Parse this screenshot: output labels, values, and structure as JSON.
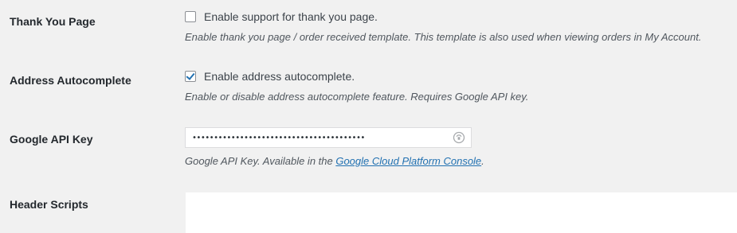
{
  "rows": [
    {
      "label": "Thank You Page",
      "checkbox_label": "Enable support for thank you page.",
      "checked": false,
      "description": "Enable thank you page / order received template. This template is also used when viewing orders in My Account."
    },
    {
      "label": "Address Autocomplete",
      "checkbox_label": "Enable address autocomplete.",
      "checked": true,
      "description": "Enable or disable address autocomplete feature. Requires Google API key."
    },
    {
      "label": "Google API Key",
      "masked_value": "••••••••••••••••••••••••••••••••••••••••",
      "description_prefix": "Google API Key. Available in the ",
      "link_text": "Google Cloud Platform Console",
      "description_suffix": "."
    },
    {
      "label": "Header Scripts"
    }
  ],
  "icons": {
    "reveal": "key-reveal-icon"
  },
  "colors": {
    "background": "#f1f1f1",
    "link": "#2271b1",
    "checkmark": "#2271b1"
  }
}
